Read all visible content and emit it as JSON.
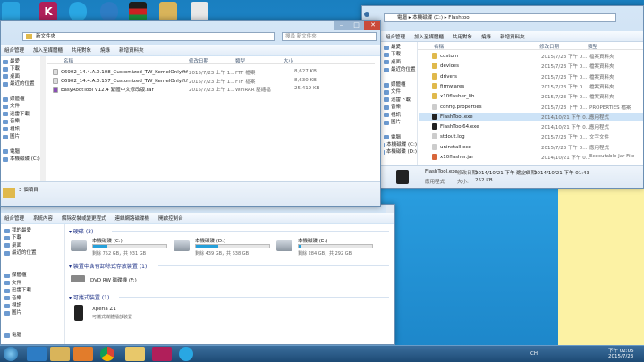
{
  "desktop": {
    "icons": [
      "skype-icon",
      "k-app-icon",
      "skype-icon",
      "ie-icon",
      "flag-icon",
      "folder-icon",
      "doc-icon"
    ],
    "sticky_note_color": "#fcf2a4"
  },
  "win1": {
    "address": "新文件夾",
    "search_placeholder": "搜尋 新文件夾",
    "toolbar": [
      "組合管理",
      "加入至媒體櫃",
      "共用對象",
      "燒錄",
      "新增資料夾"
    ],
    "nav": [
      {
        "label": "最愛",
        "icon": "star-icon"
      },
      {
        "label": "下載",
        "icon": "download-icon"
      },
      {
        "label": "桌面",
        "icon": "desktop-icon"
      },
      {
        "label": "最近的位置",
        "icon": "recent-icon"
      },
      {
        "label": "",
        "icon": ""
      },
      {
        "label": "媒體櫃",
        "icon": "library-icon"
      },
      {
        "label": "文件",
        "icon": "document-icon"
      },
      {
        "label": "迅雷下載",
        "icon": "thunder-icon"
      },
      {
        "label": "音樂",
        "icon": "music-icon"
      },
      {
        "label": "視訊",
        "icon": "video-icon"
      },
      {
        "label": "圖片",
        "icon": "picture-icon"
      },
      {
        "label": "",
        "icon": ""
      },
      {
        "label": "電腦",
        "icon": "computer-icon"
      },
      {
        "label": "本機磁碟 (C:)",
        "icon": "drive-icon"
      }
    ],
    "columns": [
      "名稱",
      "修改日期",
      "類型",
      "大小"
    ],
    "files": [
      {
        "name": "C6902_14.4.A.0.108_Customized_TW_KernelOnly.ftf",
        "date": "2015/7/23 上午 1...",
        "type": "FTF 檔案",
        "size": "8,627 KB",
        "icon": "file-icon"
      },
      {
        "name": "C6902_14.4.A.0.157_Customized_TW_KernelOnly.ftf",
        "date": "2015/7/23 上午 1...",
        "type": "FTF 檔案",
        "size": "8,630 KB",
        "icon": "file-icon"
      },
      {
        "name": "EasyRootTool V12.4 繁體中文修改版.rar",
        "date": "2015/7/23 上午 1...",
        "type": "WinRAR 壓縮檔",
        "size": "25,419 KB",
        "icon": "rar-icon"
      }
    ],
    "status": "3 個項目"
  },
  "win2": {
    "breadcrumb": [
      "電腦",
      "本機磁碟 (C:)",
      "Flashtool"
    ],
    "toolbar": [
      "組合管理",
      "加入至媒體櫃",
      "共用對象",
      "燒錄",
      "新增資料夾"
    ],
    "nav": [
      {
        "label": "最愛",
        "icon": "star-icon"
      },
      {
        "label": "下載",
        "icon": "download-icon"
      },
      {
        "label": "桌面",
        "icon": "desktop-icon"
      },
      {
        "label": "最近的位置",
        "icon": "recent-icon"
      },
      {
        "label": "",
        "icon": ""
      },
      {
        "label": "媒體櫃",
        "icon": "library-icon"
      },
      {
        "label": "文件",
        "icon": "document-icon"
      },
      {
        "label": "迅雷下載",
        "icon": "thunder-icon"
      },
      {
        "label": "音樂",
        "icon": "music-icon"
      },
      {
        "label": "視訊",
        "icon": "video-icon"
      },
      {
        "label": "圖片",
        "icon": "picture-icon"
      },
      {
        "label": "",
        "icon": ""
      },
      {
        "label": "電腦",
        "icon": "computer-icon"
      },
      {
        "label": "本機磁碟 (C:)",
        "icon": "drive-icon"
      },
      {
        "label": "本機磁碟 (D:)",
        "icon": "drive-icon"
      }
    ],
    "columns": [
      "名稱",
      "修改日期",
      "類型"
    ],
    "files": [
      {
        "name": "custom",
        "date": "2015/7/23 下午 0...",
        "type": "檔案資料夾",
        "icon": "folder-icon"
      },
      {
        "name": "devices",
        "date": "2015/7/23 下午 0...",
        "type": "檔案資料夾",
        "icon": "folder-icon"
      },
      {
        "name": "drivers",
        "date": "2015/7/23 下午 0...",
        "type": "檔案資料夾",
        "icon": "folder-icon"
      },
      {
        "name": "firmwares",
        "date": "2015/7/23 下午 0...",
        "type": "檔案資料夾",
        "icon": "folder-icon"
      },
      {
        "name": "x10flasher_lib",
        "date": "2015/7/23 下午 0...",
        "type": "檔案資料夾",
        "icon": "folder-icon"
      },
      {
        "name": "config.properties",
        "date": "2015/7/23 下午 0...",
        "type": "PROPERTIES 檔案",
        "icon": "file-icon"
      },
      {
        "name": "FlashTool.exe",
        "date": "2014/10/21 下午 0...",
        "type": "應用程式",
        "icon": "flashtool-icon",
        "selected": true
      },
      {
        "name": "FlashTool64.exe",
        "date": "2014/10/21 下午 0...",
        "type": "應用程式",
        "icon": "flashtool-icon"
      },
      {
        "name": "stdout.log",
        "date": "2015/7/23 下午 0...",
        "type": "文字文件",
        "icon": "file-icon"
      },
      {
        "name": "uninstall.exe",
        "date": "2015/7/23 下午 0...",
        "type": "應用程式",
        "icon": "uninstall-icon"
      },
      {
        "name": "x10flasher.jar",
        "date": "2014/10/21 下午 0...",
        "type": "Executable Jar File",
        "icon": "jar-icon"
      }
    ],
    "details": {
      "name": "FlashTool.exe",
      "modified_label": "修改日期:",
      "modified": "2014/10/21 下午 01:43",
      "created_label": "建立日期:",
      "created": "2014/10/21 下午 01:43",
      "type": "應用程式",
      "size_label": "大小:",
      "size": "252 KB"
    }
  },
  "win3": {
    "toolbar": [
      "組合管理",
      "系統內容",
      "解除安裝或變更程式",
      "連線網路磁碟機",
      "開啟控制台"
    ],
    "nav": [
      {
        "label": "我的最愛",
        "icon": "star-icon"
      },
      {
        "label": "下載",
        "icon": "download-icon"
      },
      {
        "label": "桌面",
        "icon": "desktop-icon"
      },
      {
        "label": "最近的位置",
        "icon": "recent-icon"
      },
      {
        "label": "",
        "icon": ""
      },
      {
        "label": "",
        "icon": ""
      },
      {
        "label": "媒體櫃",
        "icon": "library-icon"
      },
      {
        "label": "文件",
        "icon": "document-icon"
      },
      {
        "label": "迅雷下載",
        "icon": "thunder-icon"
      },
      {
        "label": "音樂",
        "icon": "music-icon"
      },
      {
        "label": "視訊",
        "icon": "video-icon"
      },
      {
        "label": "圖片",
        "icon": "picture-icon"
      },
      {
        "label": "",
        "icon": ""
      },
      {
        "label": "",
        "icon": ""
      },
      {
        "label": "電腦",
        "icon": "computer-icon"
      }
    ],
    "sections": {
      "hdd": "硬碟 (3)",
      "removable": "裝置中含有卸除式存放裝置 (1)",
      "portable": "可攜式裝置 (1)"
    },
    "drives": [
      {
        "name": "本機磁碟 (C:)",
        "free": "剩餘 752 GB，共 931 GB",
        "used_fraction": 0.19
      },
      {
        "name": "本機磁碟 (D:)",
        "free": "剩餘 439 GB，共 638 GB",
        "used_fraction": 0.31
      },
      {
        "name": "本機磁碟 (E:)",
        "free": "剩餘 284 GB，共 292 GB",
        "used_fraction": 0.03
      }
    ],
    "dvd": "DVD RW 磁碟機 (F:)",
    "portable_device": {
      "name": "Xperia Z1",
      "desc": "可攜式媒體播放裝置"
    }
  },
  "taskbar": {
    "apps": [
      "start-icon",
      "ie-icon",
      "explorer-icon",
      "media-icon",
      "chrome-icon",
      "folder-icon",
      "k-app-icon",
      "skype-icon"
    ],
    "lang": "CH",
    "time": "下午 02:05",
    "date": "2015/7/23"
  }
}
